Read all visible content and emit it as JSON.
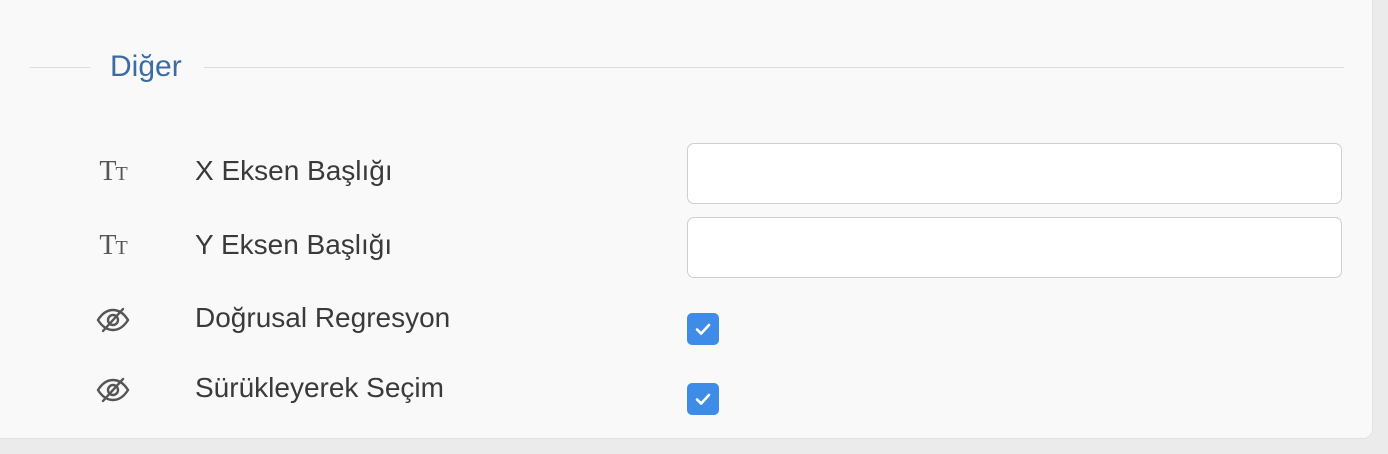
{
  "section": {
    "title": "Diğer"
  },
  "rows": [
    {
      "label": "X Eksen Başlığı",
      "icon": "text-size-icon",
      "type": "text",
      "value": "",
      "placeholder": ""
    },
    {
      "label": "Y Eksen Başlığı",
      "icon": "text-size-icon",
      "type": "text",
      "value": "",
      "placeholder": ""
    },
    {
      "label": "Doğrusal Regresyon",
      "icon": "eye-slash-icon",
      "type": "checkbox",
      "checked": true
    },
    {
      "label": "Sürükleyerek Seçim",
      "icon": "eye-slash-icon",
      "type": "checkbox",
      "checked": true
    }
  ],
  "icons": {
    "text_size_glyph_large": "T",
    "text_size_glyph_small": "T"
  },
  "colors": {
    "accent": "#3f8be8",
    "title": "#3b6da3",
    "label": "#3a3a3a",
    "background": "#f9f9f9"
  }
}
